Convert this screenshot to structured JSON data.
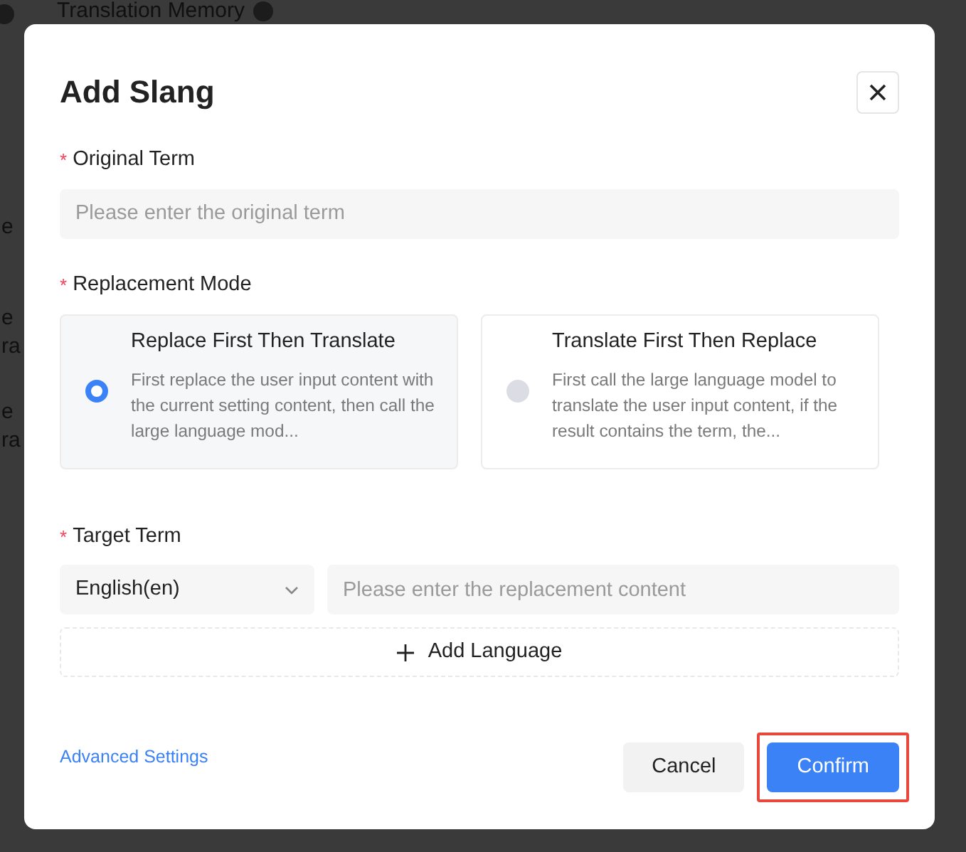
{
  "background": {
    "title": "Translation Memory",
    "fragments": [
      "e",
      "e",
      "ra",
      "e",
      "ra"
    ]
  },
  "dialog": {
    "title": "Add Slang",
    "original_term": {
      "label": "Original Term",
      "required_mark": "*",
      "placeholder": "Please enter the original term"
    },
    "replacement_mode": {
      "label": "Replacement Mode",
      "required_mark": "*",
      "options": [
        {
          "title": "Replace First Then Translate",
          "description": "First replace the user input content with the current setting content, then call the large language mod...",
          "selected": true
        },
        {
          "title": "Translate First Then Replace",
          "description": "First call the large language model to translate the user input content, if the result contains the term, the...",
          "selected": false
        }
      ]
    },
    "target_term": {
      "label": "Target Term",
      "required_mark": "*",
      "language": "English(en)",
      "placeholder": "Please enter the replacement content",
      "add_language": "Add Language"
    },
    "advanced_settings": "Advanced Settings",
    "buttons": [
      {
        "label": "Cancel",
        "kind": "secondary",
        "highlighted": false
      },
      {
        "label": "Confirm",
        "kind": "primary",
        "highlighted": true
      }
    ]
  }
}
